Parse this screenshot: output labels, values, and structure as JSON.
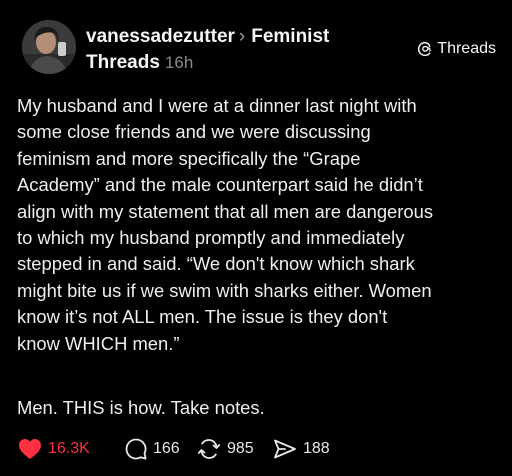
{
  "post": {
    "author": "vanessadezutter",
    "community": "Feminist Threads",
    "community_part1": "Feminist",
    "community_part2": "Threads",
    "time": "16h",
    "badge_label": "Threads",
    "body_lines": [
      "My husband and I were at a dinner last night with",
      "some close friends and we were discussing",
      "feminism and more specifically the “Grape",
      "Academy” and the male counterpart said he didn’t",
      "align with my statement that all men are dangerous",
      "to which my husband promptly and immediately",
      "stepped in and said. “We don't know which shark",
      "might bite us if we swim with sharks either. Women",
      "know it’s not ALL men. The issue is they don't",
      "know WHICH men.”"
    ],
    "closer": "Men. THIS is how. Take notes."
  },
  "actions": {
    "likes": "16.3K",
    "replies": "166",
    "reposts": "985",
    "shares": "188"
  },
  "icons": {
    "avatar": "profile-photo",
    "separator": "chevron-right-icon",
    "threads_logo": "threads-logo-icon",
    "like": "heart-filled-icon",
    "reply": "speech-bubble-icon",
    "repost": "repost-arrows-icon",
    "share": "send-arrow-icon"
  },
  "colors": {
    "background": "#000000",
    "text": "#f3f5f7",
    "muted": "#8a8a8a",
    "like_red": "#ff3040"
  }
}
